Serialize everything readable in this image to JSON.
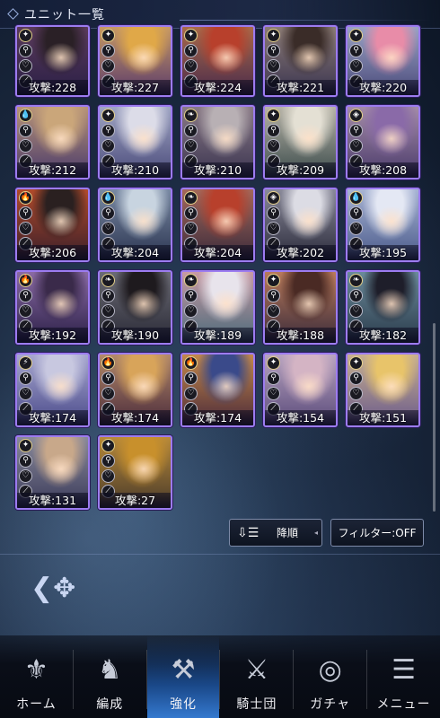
{
  "header": {
    "title": "ユニット一覧"
  },
  "cards": [
    {
      "attack": "攻撃:228",
      "elem": "✦",
      "hair": "#2a2026",
      "bg1": "#5a3a5a",
      "bg2": "#2a1f46",
      "top": true
    },
    {
      "attack": "攻撃:227",
      "elem": "✦",
      "hair": "#e0a848",
      "bg1": "#c89a64",
      "bg2": "#5a3a6a",
      "top": true
    },
    {
      "attack": "攻撃:224",
      "elem": "✦",
      "hair": "#b8402c",
      "bg1": "#a86a4a",
      "bg2": "#4a2a4a",
      "top": true
    },
    {
      "attack": "攻撃:221",
      "elem": "✦",
      "hair": "#3a2c28",
      "bg1": "#8a7a74",
      "bg2": "#3a3450",
      "top": true
    },
    {
      "attack": "攻撃:220",
      "elem": "✦",
      "hair": "#e88ca8",
      "bg1": "#9aa2c4",
      "bg2": "#4a4a7a",
      "top": true
    },
    {
      "attack": "攻撃:212",
      "elem": "💧",
      "hair": "#caa67a",
      "bg1": "#b89478",
      "bg2": "#4a3a6a"
    },
    {
      "attack": "攻撃:210",
      "elem": "✦",
      "hair": "#dcdce8",
      "bg1": "#a0a6c4",
      "bg2": "#4a4a7a"
    },
    {
      "attack": "攻撃:210",
      "elem": "❧",
      "hair": "#b8b0b4",
      "bg1": "#8a7a86",
      "bg2": "#3a3450"
    },
    {
      "attack": "攻撃:209",
      "elem": "✦",
      "hair": "#e4e0d4",
      "bg1": "#b8b4a8",
      "bg2": "#3a4a4a"
    },
    {
      "attack": "攻撃:208",
      "elem": "◈",
      "hair": "#8a6aa8",
      "bg1": "#a48ca8",
      "bg2": "#4a3a6a"
    },
    {
      "attack": "攻撃:206",
      "elem": "🔥",
      "hair": "#2a2020",
      "bg1": "#b04a2a",
      "bg2": "#3a1f2a"
    },
    {
      "attack": "攻撃:204",
      "elem": "💧",
      "hair": "#c8d4e0",
      "bg1": "#7a8aa4",
      "bg2": "#2a3450"
    },
    {
      "attack": "攻撃:204",
      "elem": "❧",
      "hair": "#b8402c",
      "bg1": "#a4685a",
      "bg2": "#3a2a3a"
    },
    {
      "attack": "攻撃:202",
      "elem": "◈",
      "hair": "#dcdce4",
      "bg1": "#8a8a9a",
      "bg2": "#2a2a3a"
    },
    {
      "attack": "攻撃:195",
      "elem": "💧",
      "hair": "#e4e8f4",
      "bg1": "#a8b4d4",
      "bg2": "#4a5a8a"
    },
    {
      "attack": "攻撃:192",
      "elem": "🔥",
      "hair": "#3a2a4a",
      "bg1": "#8a6aa4",
      "bg2": "#2a1f46"
    },
    {
      "attack": "攻撃:190",
      "elem": "❧",
      "hair": "#1e1a1e",
      "bg1": "#6a6a74",
      "bg2": "#2a2a36"
    },
    {
      "attack": "攻撃:189",
      "elem": "❧",
      "hair": "#e8e4ec",
      "bg1": "#c89aa4",
      "bg2": "#4a6a7a"
    },
    {
      "attack": "攻撃:188",
      "elem": "✦",
      "hair": "#4a2a24",
      "bg1": "#b87a5a",
      "bg2": "#3a2a3a"
    },
    {
      "attack": "攻撃:182",
      "elem": "❧",
      "hair": "#1e1e2a",
      "bg1": "#6a8a9a",
      "bg2": "#2a3a4a"
    },
    {
      "attack": "攻撃:174",
      "elem": "⚡",
      "hair": "#c8c8e0",
      "bg1": "#a8a8d0",
      "bg2": "#4a4a8a"
    },
    {
      "attack": "攻撃:174",
      "elem": "🔥",
      "hair": "#d8a45a",
      "bg1": "#b48a6a",
      "bg2": "#4a2a3a"
    },
    {
      "attack": "攻撃:174",
      "elem": "🔥",
      "hair": "#3a4a8a",
      "bg1": "#c4884a",
      "bg2": "#4a2a3a"
    },
    {
      "attack": "攻撃:154",
      "elem": "✦",
      "hair": "#d4b4c4",
      "bg1": "#b8a4c0",
      "bg2": "#5a4a7a"
    },
    {
      "attack": "攻撃:151",
      "elem": "✦",
      "hair": "#e8c46a",
      "bg1": "#c8b090",
      "bg2": "#6a5a8a"
    },
    {
      "attack": "攻撃:131",
      "elem": "✦",
      "hair": "#c8a88a",
      "bg1": "#8a8a9a",
      "bg2": "#3a3a5a"
    },
    {
      "attack": "攻撃:27",
      "elem": "✦",
      "hair": "#c8902c",
      "bg1": "#b88a3a",
      "bg2": "#4a3a2a"
    }
  ],
  "controls": {
    "sort_label": "降順",
    "filter_label": "フィルター:OFF"
  },
  "nav": [
    {
      "label": "ホーム",
      "icon": "home-icon",
      "glyph": "⚜"
    },
    {
      "label": "編成",
      "icon": "knight-helmet-icon",
      "glyph": "♞"
    },
    {
      "label": "強化",
      "icon": "enhance-icon",
      "glyph": "⚒",
      "active": true
    },
    {
      "label": "騎士団",
      "icon": "order-banner-icon",
      "glyph": "⚔"
    },
    {
      "label": "ガチャ",
      "icon": "gacha-orb-icon",
      "glyph": "◎"
    },
    {
      "label": "メニュー",
      "icon": "menu-scroll-icon",
      "glyph": "☰"
    }
  ]
}
